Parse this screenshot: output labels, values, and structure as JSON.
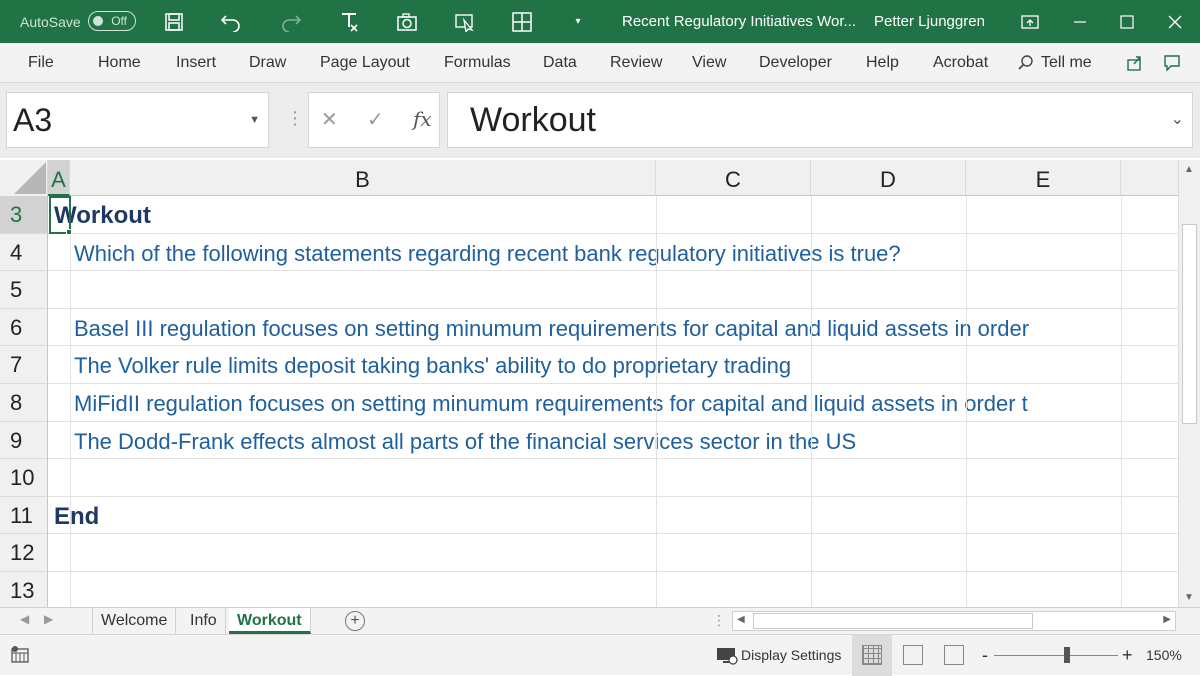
{
  "titlebar": {
    "autosave_label": "AutoSave",
    "autosave_state": "Off",
    "doc_title": "Recent Regulatory Initiatives Wor...",
    "user": "Petter Ljunggren",
    "icons": [
      "save-icon",
      "undo-icon",
      "redo-icon",
      "clear-format-icon",
      "camera-icon",
      "select-icon",
      "table-icon",
      "customize-icon",
      "ribbon-display-icon",
      "minimize-icon",
      "maximize-icon",
      "close-icon"
    ]
  },
  "ribbon": {
    "tabs": [
      "File",
      "Home",
      "Insert",
      "Draw",
      "Page Layout",
      "Formulas",
      "Data",
      "Review",
      "View",
      "Developer",
      "Help",
      "Acrobat"
    ],
    "tell_me": "Tell me"
  },
  "formula_bar": {
    "name_box": "A3",
    "fx": "fx",
    "cancel": "✕",
    "enter": "✓",
    "content": "Workout"
  },
  "grid": {
    "columns": [
      "A",
      "B",
      "C",
      "D",
      "E"
    ],
    "rows": [
      {
        "num": "3",
        "text": "Workout",
        "bold": true
      },
      {
        "num": "4",
        "text": "Which of the following statements regarding recent bank regulatory initiatives is true?",
        "bold": false
      },
      {
        "num": "5",
        "text": "",
        "bold": false
      },
      {
        "num": "6",
        "text": "Basel III regulation focuses on setting minumum requirements for capital and liquid assets in order",
        "bold": false
      },
      {
        "num": "7",
        "text": "The Volker rule limits deposit taking banks' ability to do proprietary trading",
        "bold": false
      },
      {
        "num": "8",
        "text": "MiFidII regulation focuses on setting minumum requirements for capital and liquid assets in order t",
        "bold": false
      },
      {
        "num": "9",
        "text": "The Dodd-Frank effects almost all parts of the financial services sector in the US",
        "bold": false
      },
      {
        "num": "10",
        "text": "",
        "bold": false
      },
      {
        "num": "11",
        "text": "End",
        "bold": true
      },
      {
        "num": "12",
        "text": "",
        "bold": false
      },
      {
        "num": "13",
        "text": "",
        "bold": false
      }
    ]
  },
  "sheets": {
    "tabs": [
      "Welcome",
      "Info",
      "Workout"
    ],
    "active": "Workout"
  },
  "status": {
    "display_settings": "Display Settings",
    "zoom": "150%",
    "zoom_minus": "-",
    "zoom_plus": "+"
  },
  "colors": {
    "accent": "#217346",
    "text_blue": "#1f5f9e",
    "text_navy": "#1f3864"
  }
}
